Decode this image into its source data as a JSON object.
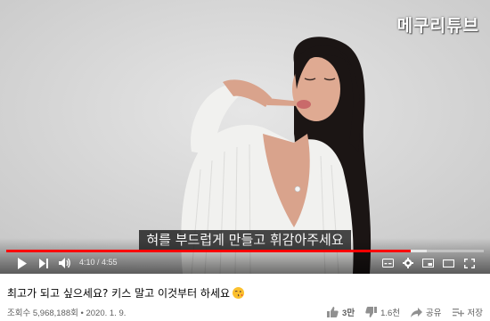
{
  "player": {
    "watermark": "메구리튜브",
    "caption": "혀를 부드럽게 만들고 휘감아주세요",
    "time_current": "4:10",
    "time_separator": " / ",
    "time_total": "4:55",
    "progress": 0.847,
    "buffered": 0.88
  },
  "video": {
    "title": "최고가 되고 싶으세요? 키스 말고 이것부터 하세요",
    "views": "조회수 5,968,188회",
    "dot": "•",
    "date": "2020. 1. 9."
  },
  "actions": {
    "like_count": "3만",
    "dislike_count": "1.6천",
    "share_label": "공유",
    "save_label": "저장"
  },
  "colors": {
    "accent": "#ff0000",
    "background": "#ffffff",
    "text_primary": "#030303",
    "text_secondary": "#606060"
  }
}
